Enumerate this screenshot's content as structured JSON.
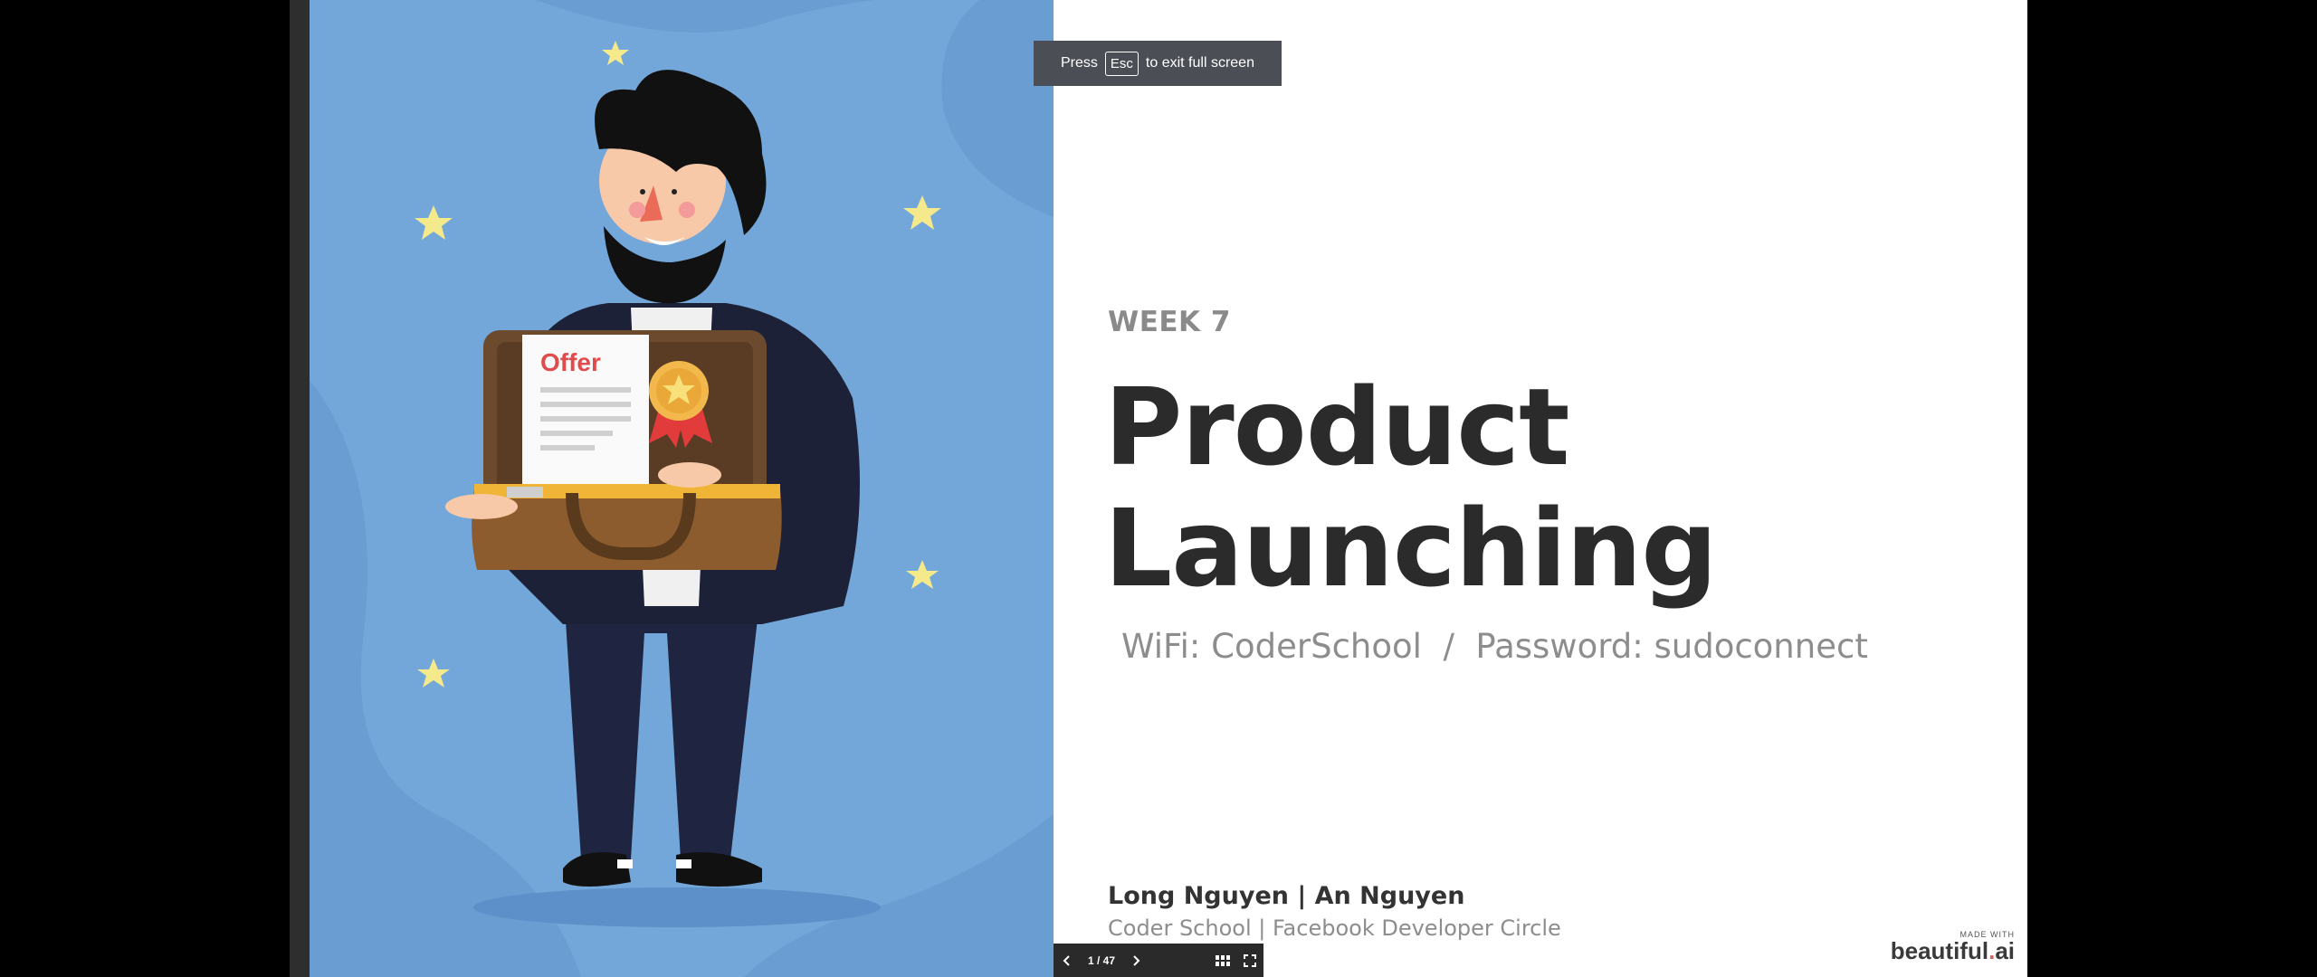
{
  "slide": {
    "week": "WEEK 7",
    "title_line1": "Product",
    "title_line2": "Launching",
    "subtitle": "WiFi: CoderSchool  /  Password: sudoconnect",
    "authors": "Long Nguyen | An Nguyen",
    "organization": "Coder School | Facebook Developer Circle",
    "illustration": {
      "offer_text": "Offer"
    },
    "brand": {
      "made_with": "MADE WITH",
      "name": "beautiful",
      "dot": ".",
      "suffix": "ai"
    }
  },
  "fullscreen_banner": {
    "press": "Press",
    "key": "Esc",
    "rest": "to exit full screen"
  },
  "navigation": {
    "page_indicator": "1 / 47",
    "prev_icon": "chevron-left-icon",
    "next_icon": "chevron-right-icon",
    "grid_icon": "grid-icon",
    "fullscreen_icon": "fullscreen-icon"
  },
  "colors": {
    "illustration_bg": "#74a7d9",
    "title": "#2b2b2b",
    "muted_text": "#8d8d8d",
    "banner_bg": "#4b4f55",
    "nav_bg": "#2a2a2a",
    "star": "#f4e98b"
  }
}
